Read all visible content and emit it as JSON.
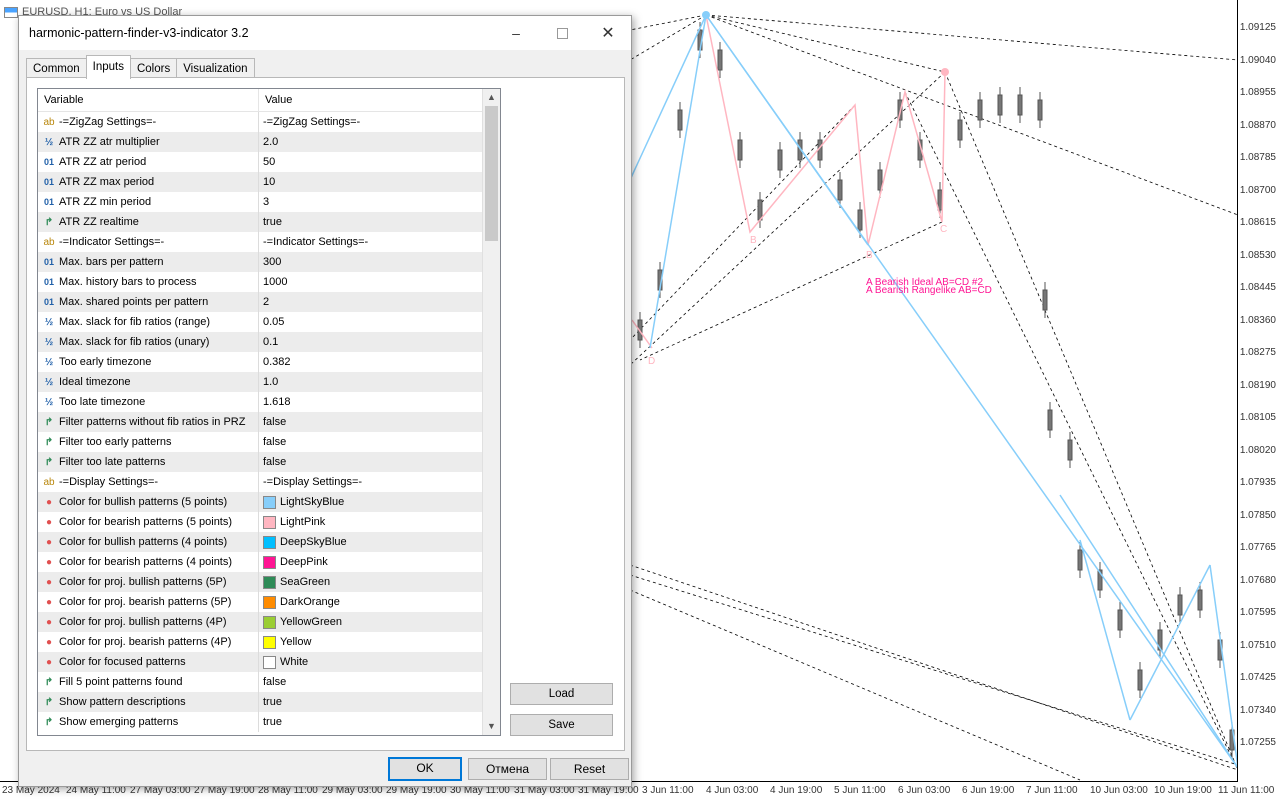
{
  "chart": {
    "title": "EURUSD, H1: Euro vs US Dollar",
    "annotations": [
      "A Bearish Ideal AB=CD #2",
      "A Bearish Rangelike AB=CD"
    ],
    "point_labels": [
      "B",
      "C",
      "D",
      "B",
      "C",
      "D"
    ],
    "price_ticks": [
      "1.09125",
      "1.09040",
      "1.08955",
      "1.08870",
      "1.08785",
      "1.08700",
      "1.08615",
      "1.08530",
      "1.08445",
      "1.08360",
      "1.08275",
      "1.08190",
      "1.08105",
      "1.08020",
      "1.07935",
      "1.07850",
      "1.07765",
      "1.07680",
      "1.07595",
      "1.07510",
      "1.07425",
      "1.07340",
      "1.07255"
    ],
    "time_ticks": [
      "23 May 2024",
      "24 May 11:00",
      "27 May 03:00",
      "27 May 19:00",
      "28 May 11:00",
      "29 May 03:00",
      "29 May 19:00",
      "30 May 11:00",
      "31 May 03:00",
      "31 May 19:00",
      "3 Jun 11:00",
      "4 Jun 03:00",
      "4 Jun 19:00",
      "5 Jun 11:00",
      "6 Jun 03:00",
      "6 Jun 19:00",
      "7 Jun 11:00",
      "10 Jun 03:00",
      "10 Jun 19:00",
      "11 Jun 11:00"
    ],
    "colors": {
      "bullish": "#87CEFA",
      "bearish": "#FFB6C1",
      "label": "#FF1493"
    }
  },
  "dialog": {
    "title": "harmonic-pattern-finder-v3-indicator 3.2",
    "tabs": [
      "Common",
      "Inputs",
      "Colors",
      "Visualization"
    ],
    "active_tab": "Inputs",
    "columns": {
      "variable": "Variable",
      "value": "Value"
    },
    "rows": [
      {
        "type": "ab",
        "name": "-=ZigZag Settings=-",
        "value": "-=ZigZag Settings=-"
      },
      {
        "type": "frac",
        "name": "ATR ZZ atr multiplier",
        "value": "2.0"
      },
      {
        "type": "int",
        "name": "ATR ZZ atr period",
        "value": "50"
      },
      {
        "type": "int",
        "name": "ATR ZZ max period",
        "value": "10"
      },
      {
        "type": "int",
        "name": "ATR ZZ min period",
        "value": "3"
      },
      {
        "type": "bool",
        "name": "ATR ZZ realtime",
        "value": "true"
      },
      {
        "type": "ab",
        "name": "-=Indicator Settings=-",
        "value": "-=Indicator Settings=-"
      },
      {
        "type": "int",
        "name": "Max. bars per pattern",
        "value": "300"
      },
      {
        "type": "int",
        "name": "Max. history bars to process",
        "value": "1000"
      },
      {
        "type": "int",
        "name": "Max. shared points per pattern",
        "value": "2"
      },
      {
        "type": "frac",
        "name": "Max. slack for fib ratios (range)",
        "value": "0.05"
      },
      {
        "type": "frac",
        "name": "Max. slack for fib ratios (unary)",
        "value": "0.1"
      },
      {
        "type": "frac",
        "name": "Too early timezone",
        "value": "0.382"
      },
      {
        "type": "frac",
        "name": "Ideal timezone",
        "value": "1.0"
      },
      {
        "type": "frac",
        "name": "Too late timezone",
        "value": "1.618"
      },
      {
        "type": "bool",
        "name": "Filter patterns without fib ratios in PRZ",
        "value": "false"
      },
      {
        "type": "bool",
        "name": "Filter too early patterns",
        "value": "false"
      },
      {
        "type": "bool",
        "name": "Filter too late patterns",
        "value": "false"
      },
      {
        "type": "ab",
        "name": "-=Display Settings=-",
        "value": "-=Display Settings=-"
      },
      {
        "type": "clr",
        "name": "Color for bullish patterns (5 points)",
        "value": "LightSkyBlue",
        "color": "#87CEFA"
      },
      {
        "type": "clr",
        "name": "Color for bearish patterns (5 points)",
        "value": "LightPink",
        "color": "#FFB6C1"
      },
      {
        "type": "clr",
        "name": "Color for bullish patterns (4 points)",
        "value": "DeepSkyBlue",
        "color": "#00BFFF"
      },
      {
        "type": "clr",
        "name": "Color for bearish patterns (4 points)",
        "value": "DeepPink",
        "color": "#FF1493"
      },
      {
        "type": "clr",
        "name": "Color for proj. bullish patterns (5P)",
        "value": "SeaGreen",
        "color": "#2E8B57"
      },
      {
        "type": "clr",
        "name": "Color for proj. bearish patterns (5P)",
        "value": "DarkOrange",
        "color": "#FF8C00"
      },
      {
        "type": "clr",
        "name": "Color for proj. bullish patterns (4P)",
        "value": "YellowGreen",
        "color": "#9ACD32"
      },
      {
        "type": "clr",
        "name": "Color for proj. bearish patterns (4P)",
        "value": "Yellow",
        "color": "#FFFF00"
      },
      {
        "type": "clr",
        "name": "Color for focused patterns",
        "value": "White",
        "color": "#FFFFFF"
      },
      {
        "type": "bool",
        "name": "Fill 5 point patterns found",
        "value": "false"
      },
      {
        "type": "bool",
        "name": "Show pattern descriptions",
        "value": "true"
      },
      {
        "type": "bool",
        "name": "Show emerging patterns",
        "value": "true"
      }
    ],
    "buttons": {
      "load": "Load",
      "save": "Save",
      "ok": "OK",
      "cancel": "Отмена",
      "reset": "Reset"
    },
    "icons": {
      "close": "close-icon",
      "minimize": "minimize-icon",
      "maximize": "maximize-icon"
    }
  }
}
